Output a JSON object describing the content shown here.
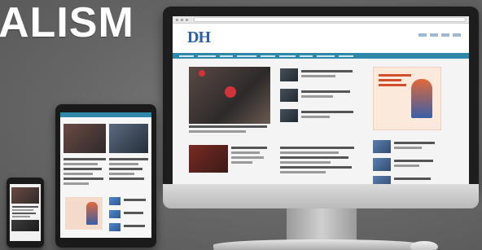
{
  "hero": {
    "headline": "ALISM"
  },
  "desktop_site": {
    "logo_text": "DH"
  },
  "devices": [
    "phone",
    "tablet",
    "desktop-monitor"
  ],
  "colors": {
    "nav_accent": "#2f88a8",
    "logo_blue": "#2b5fa8",
    "highlight_red": "#d0333a",
    "background_gray": "#6f6f6f"
  }
}
